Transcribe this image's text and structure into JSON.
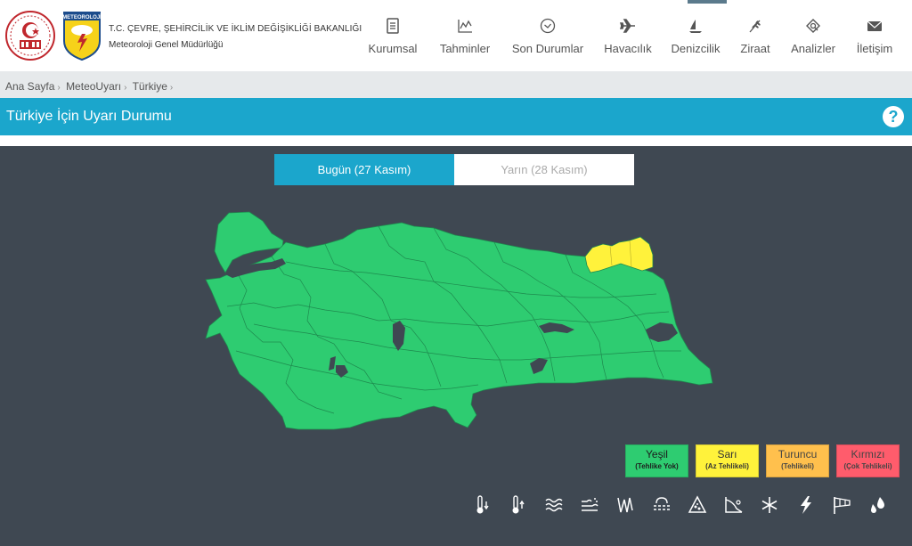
{
  "header": {
    "ministry": "T.C. ÇEVRE, ŞEHİRCİLİK VE İKLİM DEĞİŞİKLİĞİ BAKANLIĞI",
    "directorate": "Meteoroloji Genel Müdürlüğü",
    "logo_text": "METEOROLOJİ"
  },
  "nav": [
    {
      "label": "Kurumsal",
      "icon": "document-icon"
    },
    {
      "label": "Tahminler",
      "icon": "chart-icon"
    },
    {
      "label": "Son Durumlar",
      "icon": "clock-icon"
    },
    {
      "label": "Havacılık",
      "icon": "airplane-icon"
    },
    {
      "label": "Denizcilik",
      "icon": "sailboat-icon"
    },
    {
      "label": "Ziraat",
      "icon": "wheat-icon"
    },
    {
      "label": "Analizler",
      "icon": "analysis-icon"
    },
    {
      "label": "İletişim",
      "icon": "envelope-icon"
    }
  ],
  "breadcrumb": [
    "Ana Sayfa",
    "MeteoUyarı",
    "Türkiye"
  ],
  "page_title": "Türkiye İçin Uyarı Durumu",
  "tabs": {
    "today": "Bugün (27 Kasım)",
    "tomorrow": "Yarın (28 Kasım)"
  },
  "map": {
    "default_level": "Yeşil",
    "highlighted_provinces_level": "Sarı",
    "colors": {
      "green": "#2ecc71",
      "yellow": "#fff23b",
      "orange": "#ffc04d",
      "red": "#ff5c6c",
      "background": "#3f4852",
      "accent": "#1ba6cc"
    }
  },
  "legend": [
    {
      "title": "Yeşil",
      "sub": "(Tehlike Yok)"
    },
    {
      "title": "Sarı",
      "sub": "(Az Tehlikeli)"
    },
    {
      "title": "Turuncu",
      "sub": "(Tehlikeli)"
    },
    {
      "title": "Kırmızı",
      "sub": "(Çok Tehlikeli)"
    }
  ],
  "hazard_icons": [
    "cold-thermometer-icon",
    "hot-thermometer-icon",
    "waves-icon",
    "dust-storm-icon",
    "wind-gust-icon",
    "fog-icon",
    "avalanche-icon",
    "landslide-icon",
    "snowflake-icon",
    "lightning-icon",
    "windsock-icon",
    "rain-drops-icon"
  ]
}
